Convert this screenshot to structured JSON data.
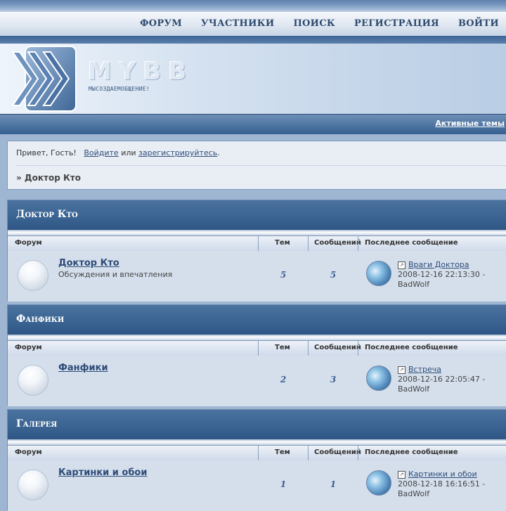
{
  "nav": [
    "ФОРУМ",
    "УЧАСТНИКИ",
    "ПОИСК",
    "РЕГИСТРАЦИЯ",
    "ВОЙТИ"
  ],
  "logo": {
    "text": "MYBB",
    "slogan": "МЫСОЗДАЕМОБЩЕНИЕ!"
  },
  "active_topics": "Активные темы",
  "welcome": {
    "greeting": "Привет, Гость!",
    "login_link": "Войдите",
    "or_text": "или",
    "register_link": "зарегистрируйтесь",
    "end": "."
  },
  "breadcrumb": "» Доктор Кто",
  "columns": {
    "forum": "Форум",
    "topics": "Тем",
    "posts": "Сообщений",
    "last": "Последнее сообщение"
  },
  "categories": [
    {
      "title": "Доктор Кто",
      "forum": "Доктор Кто",
      "description": "Обсуждения и впечатления",
      "topics": "5",
      "posts": "5",
      "last_title": "Враги Доктора",
      "last_date": "2008-12-16 22:13:30 -",
      "last_user": "BadWolf"
    },
    {
      "title": "Фанфики",
      "forum": "Фанфики",
      "description": "",
      "topics": "2",
      "posts": "3",
      "last_title": "Встреча",
      "last_date": "2008-12-16 22:05:47 -",
      "last_user": "BadWolf"
    },
    {
      "title": "Галерея",
      "forum": "Картинки и обои",
      "description": "",
      "topics": "1",
      "posts": "1",
      "last_title": "Картинки и обои",
      "last_date": "2008-12-18 16:16:51 -",
      "last_user": "BadWolf"
    }
  ],
  "icons": [
    "logo-chevrons-icon",
    "forum-status-icon",
    "post-icon",
    "user-avatar-icon"
  ]
}
